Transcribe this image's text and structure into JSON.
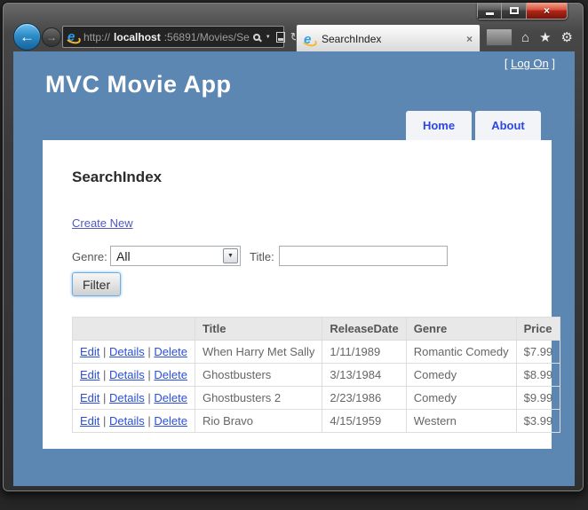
{
  "window": {
    "caption": {
      "minimize": "minimize",
      "maximize": "maximize",
      "close_glyph": "×"
    }
  },
  "browser": {
    "back_glyph": "←",
    "forward_glyph": "→",
    "address": {
      "protocol": "http://",
      "host": "localhost",
      "path": ":56891/Movies/Se"
    },
    "address_icons": {
      "dropdown": "▼",
      "refresh": "↻",
      "stop": "×"
    },
    "tab": {
      "title": "SearchIndex",
      "close_glyph": "×"
    },
    "chrome_icons": {
      "home": "⌂",
      "favorites": "★",
      "settings": "⚙"
    }
  },
  "page": {
    "logon": {
      "prefix": "[ ",
      "link": "Log On",
      "suffix": " ]"
    },
    "app_title": "MVC Movie App",
    "nav": {
      "home": "Home",
      "about": "About"
    },
    "heading": "SearchIndex",
    "create_new": "Create New",
    "filter": {
      "genre_label": "Genre:",
      "genre_value": "All",
      "genre_arrow": "▼",
      "title_label": "Title:",
      "title_value": "",
      "button_label": "Filter"
    },
    "table": {
      "headers": {
        "actions": "",
        "title": "Title",
        "release_date": "ReleaseDate",
        "genre": "Genre",
        "price": "Price"
      },
      "row_actions": [
        "Edit",
        "Details",
        "Delete"
      ],
      "separator": " | ",
      "rows": [
        {
          "title": "When Harry Met Sally",
          "release_date": "1/11/1989",
          "genre": "Romantic Comedy",
          "price": "$7.99"
        },
        {
          "title": "Ghostbusters",
          "release_date": "3/13/1984",
          "genre": "Comedy",
          "price": "$8.99"
        },
        {
          "title": "Ghostbusters 2",
          "release_date": "2/23/1986",
          "genre": "Comedy",
          "price": "$9.99"
        },
        {
          "title": "Rio Bravo",
          "release_date": "4/15/1959",
          "genre": "Western",
          "price": "$3.99"
        }
      ]
    }
  },
  "colors": {
    "page_background": "#5c87b2",
    "link_blue": "#2a4fd9",
    "visited_link": "#505abc",
    "nav_text": "#2b47e6",
    "frame_dark": "#303030"
  }
}
